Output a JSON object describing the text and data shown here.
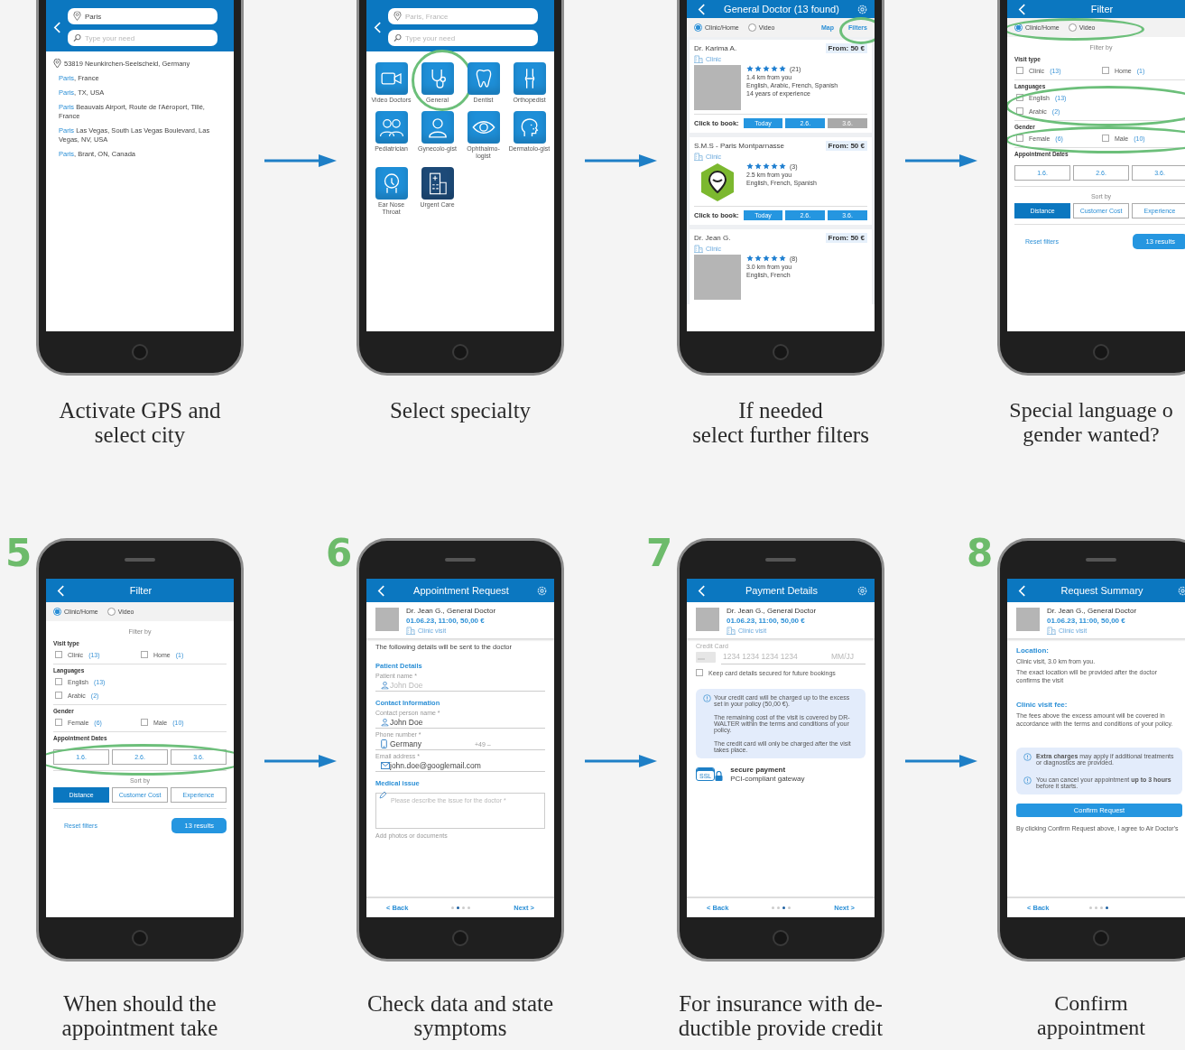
{
  "steps": [
    {
      "caption": [
        "Activate GPS and",
        "select city"
      ],
      "screen": {
        "kind": "location_search",
        "location": {
          "value": "Paris"
        },
        "need": {
          "placeholder": "Type your need"
        },
        "current_location": "53819 Neunkirchen-Seelscheid, Germany",
        "suggestions": [
          {
            "match": "Paris",
            "rest": ", France"
          },
          {
            "match": "Paris",
            "rest": ", TX, USA"
          },
          {
            "match": "Paris",
            "rest": " Beauvais Airport, Route de l'Aéroport, Tillé, France"
          },
          {
            "match": "Paris",
            "rest": " Las Vegas, South Las Vegas Boulevard, Las Vegas, NV, USA"
          },
          {
            "match": "Paris",
            "rest": ", Brant, ON, Canada"
          }
        ]
      }
    },
    {
      "caption": [
        "Select specialty"
      ],
      "screen": {
        "kind": "specialty_grid",
        "location": {
          "placeholder": "Paris, France"
        },
        "need": {
          "placeholder": "Type your need"
        },
        "tiles": [
          {
            "label": "Video Doctors",
            "color": "#1e8fd8",
            "circled": false
          },
          {
            "label": "General",
            "color": "#1e8fd8",
            "circled": true
          },
          {
            "label": "Dentist",
            "color": "#1e8fd8",
            "circled": false
          },
          {
            "label": "Orthopedist",
            "color": "#1e8fd8",
            "circled": false
          },
          {
            "label": "Pediatrician",
            "color": "#1e8fd8",
            "circled": false
          },
          {
            "label": "Gynecolo-gist",
            "color": "#1e8fd8",
            "circled": false
          },
          {
            "label": "Ophthalmo-logist",
            "color": "#1e8fd8",
            "circled": false
          },
          {
            "label": "Dermatolo-gist",
            "color": "#1e8fd8",
            "circled": false
          },
          {
            "label": "Ear Nose Throat",
            "color": "#1e8fd8",
            "circled": false
          },
          {
            "label": "Urgent Care",
            "color": "#1d4a78",
            "circled": false
          }
        ]
      }
    },
    {
      "caption": [
        "If needed",
        "select further filters"
      ],
      "screen": {
        "kind": "results_list",
        "title": "General Doctor (13 found)",
        "settings_button": true,
        "modes": [
          {
            "label": "Clinic/Home",
            "selected": true
          },
          {
            "label": "Video",
            "selected": false
          }
        ],
        "links": [
          {
            "label": "Map",
            "circled": false
          },
          {
            "label": "Filters",
            "circled": true
          }
        ],
        "doctors": [
          {
            "kind": "photo",
            "name": "Dr. Karima A.",
            "price": "From: 50 €",
            "type": "Clinic",
            "stars": 5,
            "reviews": "(21)",
            "lines": [
              "1.4 km from you",
              "English, Arabic, French, Spanish",
              "14 years of experience"
            ],
            "book_label": "Click to book:",
            "slots": [
              {
                "label": "Today",
                "available": true
              },
              {
                "label": "2.6.",
                "available": true
              },
              {
                "label": "3.6.",
                "available": false
              }
            ]
          },
          {
            "kind": "logo",
            "name": "S.M.S - Paris Montparnasse",
            "price": "From: 50 €",
            "type": "Clinic",
            "stars": 5,
            "reviews": "(3)",
            "lines": [
              "2.5 km from you",
              "English, French, Spanish"
            ],
            "book_label": "Click to book:",
            "slots": [
              {
                "label": "Today",
                "available": true
              },
              {
                "label": "2.6.",
                "available": true
              },
              {
                "label": "3.6.",
                "available": true
              }
            ]
          },
          {
            "kind": "photo",
            "name": "Dr. Jean G.",
            "price": "From: 50 €",
            "type": "Clinic",
            "stars": 5,
            "reviews": "(8)",
            "lines": [
              "3.0 km from you",
              "English, French"
            ]
          }
        ]
      }
    },
    {
      "caption": [
        "Special language o",
        "gender wanted?"
      ],
      "screen": {
        "kind": "filter",
        "title": "Filter",
        "modes": [
          {
            "label": "Clinic/Home",
            "selected": true
          },
          {
            "label": "Video",
            "selected": false
          }
        ],
        "modes_circled": true,
        "filter_by": "Filter by",
        "groups": [
          {
            "title": "Visit type",
            "kind": "inline",
            "circled": false,
            "options": [
              {
                "label": "Clinic",
                "count": "(13)",
                "checked": false
              },
              {
                "label": "Home",
                "count": "(1)",
                "checked": false
              }
            ]
          },
          {
            "title": "Languages",
            "kind": "stacked",
            "circled": true,
            "options": [
              {
                "label": "English",
                "count": "(13)",
                "checked": false
              },
              {
                "label": "Arabic",
                "count": "(2)",
                "checked": false
              }
            ]
          },
          {
            "title": "Gender",
            "kind": "inline",
            "circled": true,
            "options": [
              {
                "label": "Female",
                "count": "(6)",
                "checked": false
              },
              {
                "label": "Male",
                "count": "(10)",
                "checked": false
              }
            ]
          }
        ],
        "dates_title": "Appointment Dates",
        "dates": [
          "1.6.",
          "2.6.",
          "3.6."
        ],
        "dates_circled": false,
        "sort_title": "Sort by",
        "sorts": [
          {
            "label": "Distance",
            "selected": true
          },
          {
            "label": "Customer Cost",
            "selected": false
          },
          {
            "label": "Experience",
            "selected": false
          }
        ],
        "reset": "Reset filters",
        "results": "13 results"
      }
    },
    {
      "number": "5",
      "caption": [
        "When should the",
        "appointment take"
      ],
      "screen": {
        "kind": "filter",
        "title": "Filter",
        "modes": [
          {
            "label": "Clinic/Home",
            "selected": true
          },
          {
            "label": "Video",
            "selected": false
          }
        ],
        "modes_circled": false,
        "filter_by": "Filter by",
        "groups": [
          {
            "title": "Visit type",
            "kind": "inline",
            "circled": false,
            "options": [
              {
                "label": "Clinic",
                "count": "(13)",
                "checked": false
              },
              {
                "label": "Home",
                "count": "(1)",
                "checked": false
              }
            ]
          },
          {
            "title": "Languages",
            "kind": "stacked",
            "circled": false,
            "options": [
              {
                "label": "English",
                "count": "(13)",
                "checked": false
              },
              {
                "label": "Arabic",
                "count": "(2)",
                "checked": false
              }
            ]
          },
          {
            "title": "Gender",
            "kind": "inline",
            "circled": false,
            "options": [
              {
                "label": "Female",
                "count": "(6)",
                "checked": false
              },
              {
                "label": "Male",
                "count": "(10)",
                "checked": false
              }
            ]
          }
        ],
        "dates_title": "Appointment Dates",
        "dates": [
          "1.6.",
          "2.6.",
          "3.6."
        ],
        "dates_circled": true,
        "sort_title": "Sort by",
        "sorts": [
          {
            "label": "Distance",
            "selected": true
          },
          {
            "label": "Customer Cost",
            "selected": false
          },
          {
            "label": "Experience",
            "selected": false
          }
        ],
        "reset": "Reset filters",
        "results": "13 results"
      }
    },
    {
      "number": "6",
      "caption": [
        "Check data and state",
        "symptoms"
      ],
      "screen": {
        "kind": "appointment_request",
        "title": "Appointment Request",
        "settings_button": true,
        "doctor": {
          "name": "Dr. Jean G., General Doctor",
          "details": "01.06.23, 11:00, 50,00 €",
          "visit": "Clinic visit"
        },
        "intro": "The following details will be sent to the doctor",
        "sections": [
          {
            "title": "Patient Details",
            "fields": [
              {
                "label": "Patient name *",
                "placeholder": "John Doe",
                "kind": "person"
              }
            ]
          },
          {
            "title": "Contact Information",
            "fields": [
              {
                "label": "Contact person name *",
                "value": "John Doe",
                "kind": "person"
              },
              {
                "label": "Phone number *",
                "value": "Germany",
                "suffix": "+49 –",
                "kind": "phone"
              },
              {
                "label": "Email address *",
                "value": "john.doe@googlemail.com",
                "kind": "email"
              }
            ]
          },
          {
            "title": "Medical issue",
            "textarea": {
              "placeholder": "Please describe the issue for the doctor *"
            }
          }
        ],
        "attachments_label": "Add photos or documents",
        "footer": {
          "back": "< Back",
          "next": "Next >",
          "pages": [
            {
              "selected": false
            },
            {
              "selected": true
            },
            {
              "selected": false
            },
            {
              "selected": false
            }
          ]
        }
      }
    },
    {
      "number": "7",
      "caption": [
        "For insurance with de-",
        "ductible provide credit"
      ],
      "screen": {
        "kind": "payment",
        "title": "Payment Details",
        "settings_button": true,
        "doctor": {
          "name": "Dr. Jean G., General Doctor",
          "details": "01.06.23, 11:00, 50,00 €",
          "visit": "Clinic visit"
        },
        "card_label": "Credit Card",
        "card_number": {
          "placeholder": "1234 1234 1234 1234"
        },
        "card_expiry": {
          "placeholder": "MM/JJ"
        },
        "keep_card": {
          "label": "Keep card details secured for future bookings",
          "checked": false
        },
        "info": [
          "Your credit card will be charged up to the excess set in your policy (50,00 €).",
          "The remaining cost of the visit is covered by DR-WALTER within the terms and conditions of your policy.",
          "The credit card will only be charged after the visit takes place."
        ],
        "ssl_label": "SSL",
        "secure_title": "secure payment",
        "secure_text": "PCI-compliant gateway",
        "footer": {
          "back": "< Back",
          "next": "Next >",
          "pages": [
            {
              "selected": false
            },
            {
              "selected": false
            },
            {
              "selected": true
            },
            {
              "selected": false
            }
          ]
        }
      }
    },
    {
      "number": "8",
      "caption": [
        "Confirm",
        "appointment"
      ],
      "screen": {
        "kind": "summary",
        "title": "Request Summary",
        "settings_button": true,
        "doctor": {
          "name": "Dr. Jean G., General Doctor",
          "details": "01.06.23, 11:00, 50,00 €",
          "visit": "Clinic visit"
        },
        "sections": [
          {
            "title": "Location:",
            "paragraphs": [
              "Clinic visit, 3.0 km from you.",
              "The exact location will be provided after the doctor confirms the visit"
            ]
          },
          {
            "title": "Clinic visit fee:",
            "paragraphs": [
              "The fees above the excess amount will be covered in accordance with the terms and conditions of your policy."
            ]
          }
        ],
        "notices": [
          "**Extra charges** may apply if additional treatments or diagnostics are provided.",
          "You can cancel your appointment **up to 3 hours** before it starts."
        ],
        "confirm": "Confirm Request",
        "legal": "By clicking Confirm Request above, I agree to Air Doctor's",
        "footer": {
          "back": "< Back",
          "pages": [
            {
              "selected": false
            },
            {
              "selected": false
            },
            {
              "selected": false
            },
            {
              "selected": true
            }
          ]
        }
      }
    }
  ]
}
